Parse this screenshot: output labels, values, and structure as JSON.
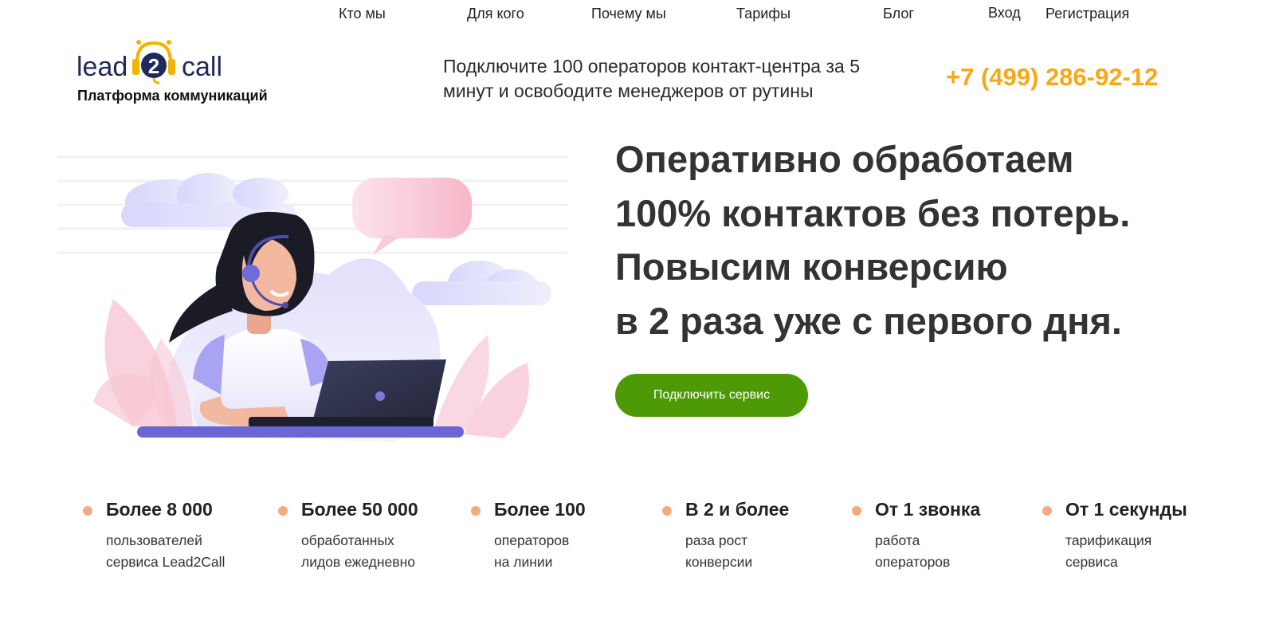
{
  "nav": {
    "items": [
      {
        "label": "Кто мы"
      },
      {
        "label": "Для кого"
      },
      {
        "label": "Почему мы"
      },
      {
        "label": "Тарифы"
      },
      {
        "label": "Блог"
      },
      {
        "label": "Вход"
      },
      {
        "label": "Регистрация"
      }
    ]
  },
  "logo": {
    "left_text": "lead",
    "badge_text": "2",
    "right_text": "call",
    "tagline": "Платформа коммуникаций"
  },
  "header": {
    "slogan_line1": "Подключите 100 операторов контакт-центра за 5",
    "slogan_line2": "минут и освободите менеджеров от рутины",
    "phone": "+7 (499) 286-92-12"
  },
  "hero": {
    "title_lines": [
      "Оперативно обработаем",
      "100% контактов без потерь.",
      "Повысим конверсию",
      "в 2 раза уже с первого дня."
    ],
    "cta_label": "Подключить сервис"
  },
  "stats": [
    {
      "number": "Более 8 000",
      "line1": "пользователей",
      "line2": "сервиса Lead2Call"
    },
    {
      "number": "Более 50 000",
      "line1": "обработанных",
      "line2": "лидов ежедневно"
    },
    {
      "number": "Более 100",
      "line1": "операторов",
      "line2": "на линии"
    },
    {
      "number": "В 2 и более",
      "line1": "раза рост",
      "line2": "конверсии"
    },
    {
      "number": "От 1 звонка",
      "line1": "работа",
      "line2": "операторов"
    },
    {
      "number": "От 1 секунды",
      "line1": "тарификация",
      "line2": "сервиса"
    }
  ],
  "colors": {
    "accent_phone": "#f7a814",
    "cta_green": "#4e9a06",
    "bullet_peach": "#f6a97a",
    "logo_yellow": "#f5b301",
    "logo_navy": "#1f2a5a"
  },
  "icons": [
    "headset-logo-icon",
    "operator-illustration",
    "bullet-dot-icon"
  ]
}
